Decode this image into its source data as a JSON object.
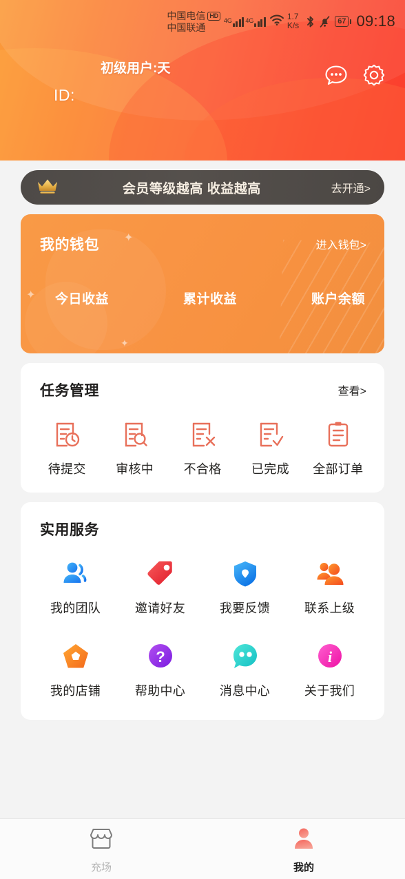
{
  "status_bar": {
    "carrier_primary": "中国电信",
    "carrier_secondary": "中国联通",
    "hd_badge": "HD",
    "net_type_1": "4G",
    "net_type_2": "4G",
    "net_speed_value": "1.7",
    "net_speed_unit": "K/s",
    "battery_percent": "67",
    "time": "09:18"
  },
  "header": {
    "user_level": "初级用户:天",
    "user_id": "ID:",
    "message_icon": "chat-dots-icon",
    "settings_icon": "gear-icon"
  },
  "vip_banner": {
    "crown_icon": "crown-icon",
    "text": "会员等级越高 收益越高",
    "action": "去开通>"
  },
  "wallet": {
    "title": "我的钱包",
    "enter_label": "进入钱包>",
    "stats": [
      {
        "label": "今日收益",
        "value": ""
      },
      {
        "label": "累计收益",
        "value": ""
      },
      {
        "label": "账户余额",
        "value": ""
      }
    ]
  },
  "task_management": {
    "title": "任务管理",
    "more": "查看>",
    "items": [
      {
        "label": "待提交",
        "icon": "doc-clock-icon"
      },
      {
        "label": "审核中",
        "icon": "doc-search-icon"
      },
      {
        "label": "不合格",
        "icon": "doc-x-icon"
      },
      {
        "label": "已完成",
        "icon": "doc-check-icon"
      },
      {
        "label": "全部订单",
        "icon": "clipboard-icon"
      }
    ]
  },
  "services": {
    "title": "实用服务",
    "row1": [
      {
        "label": "我的团队",
        "icon": "people-blue-icon"
      },
      {
        "label": "邀请好友",
        "icon": "tag-red-icon"
      },
      {
        "label": "我要反馈",
        "icon": "shield-blue-icon"
      },
      {
        "label": "联系上级",
        "icon": "people-orange-icon"
      }
    ],
    "row2": [
      {
        "label": "我的店铺",
        "icon": "pentagon-shop-icon"
      },
      {
        "label": "帮助中心",
        "icon": "question-purple-icon"
      },
      {
        "label": "消息中心",
        "icon": "chat-cyan-icon"
      },
      {
        "label": "关于我们",
        "icon": "info-pink-icon"
      }
    ]
  },
  "bottom_nav": {
    "items": [
      {
        "label": "充场",
        "icon": "store-icon",
        "active": false
      },
      {
        "label": "我的",
        "icon": "person-icon",
        "active": true
      }
    ]
  },
  "colors": {
    "header_start": "#fb9b3a",
    "header_end": "#f93f2f",
    "vip_bg": "#4e4a47",
    "wallet_bg": "#f99a46",
    "task_icon": "#e8705a",
    "nav_active": "#f4695f",
    "nav_inactive": "#b3b3b3"
  }
}
